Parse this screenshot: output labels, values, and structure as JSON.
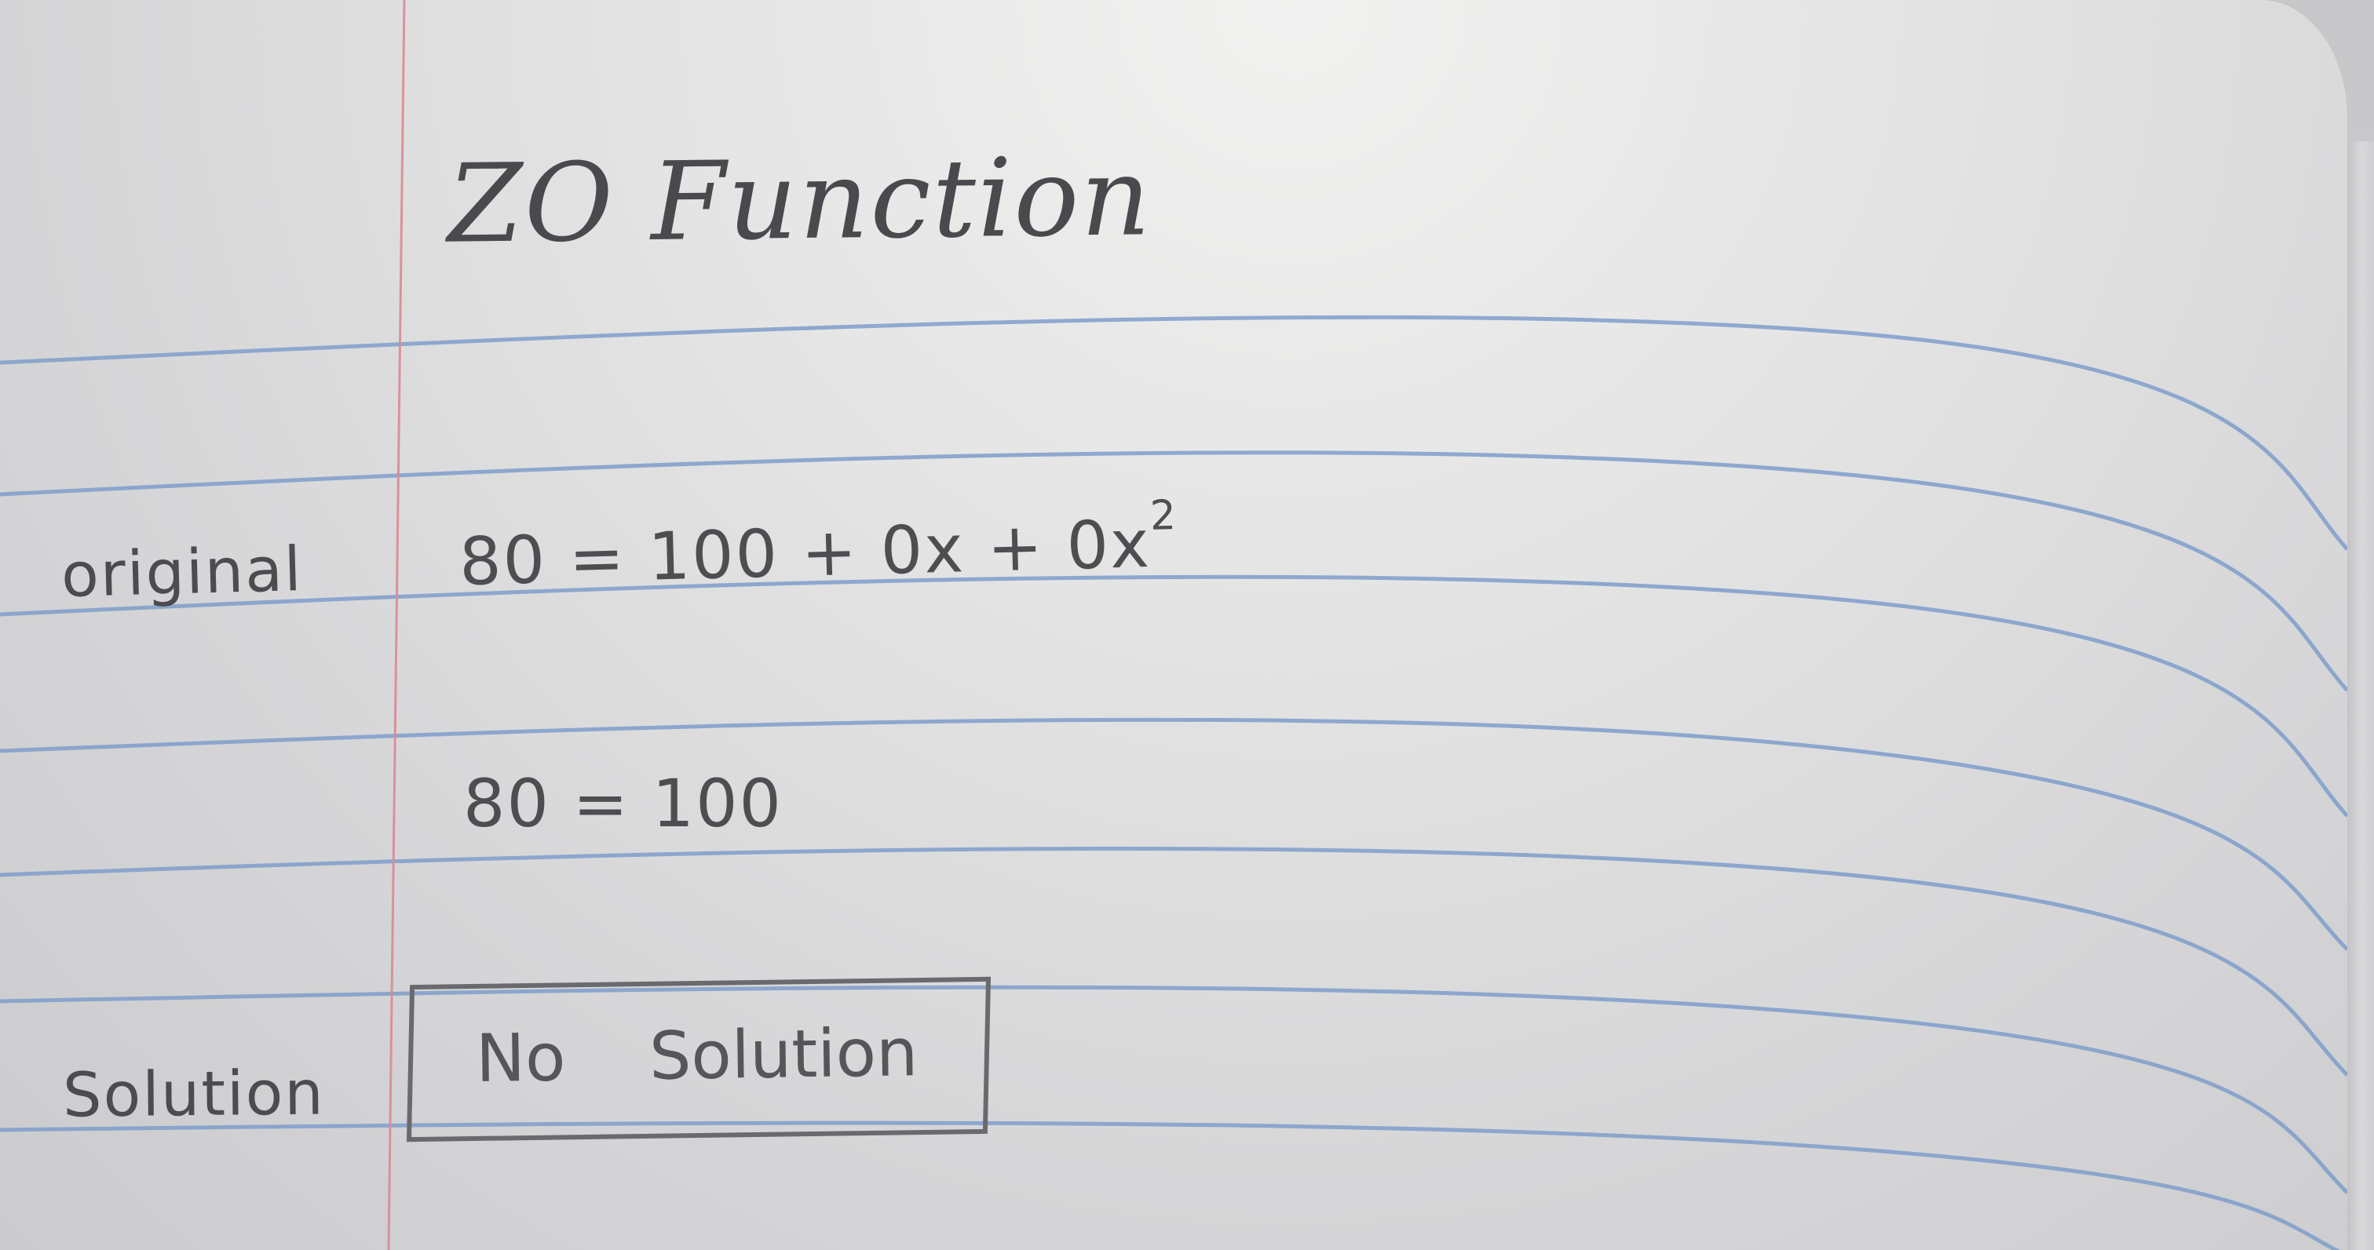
{
  "notebook": {
    "title": "ZO Function",
    "rows": [
      {
        "label": "original",
        "content": "80 = 100 + 0x + 0x"
      },
      {
        "label": "",
        "content": "80 = 100"
      },
      {
        "label": "Solution",
        "content": "No Solution"
      }
    ],
    "exponent": "2"
  },
  "colors": {
    "paper": "#e4e4e4",
    "rule_line": "#7f9ecb",
    "margin_line": "#d98a93",
    "ink": "#3a3a3e"
  }
}
